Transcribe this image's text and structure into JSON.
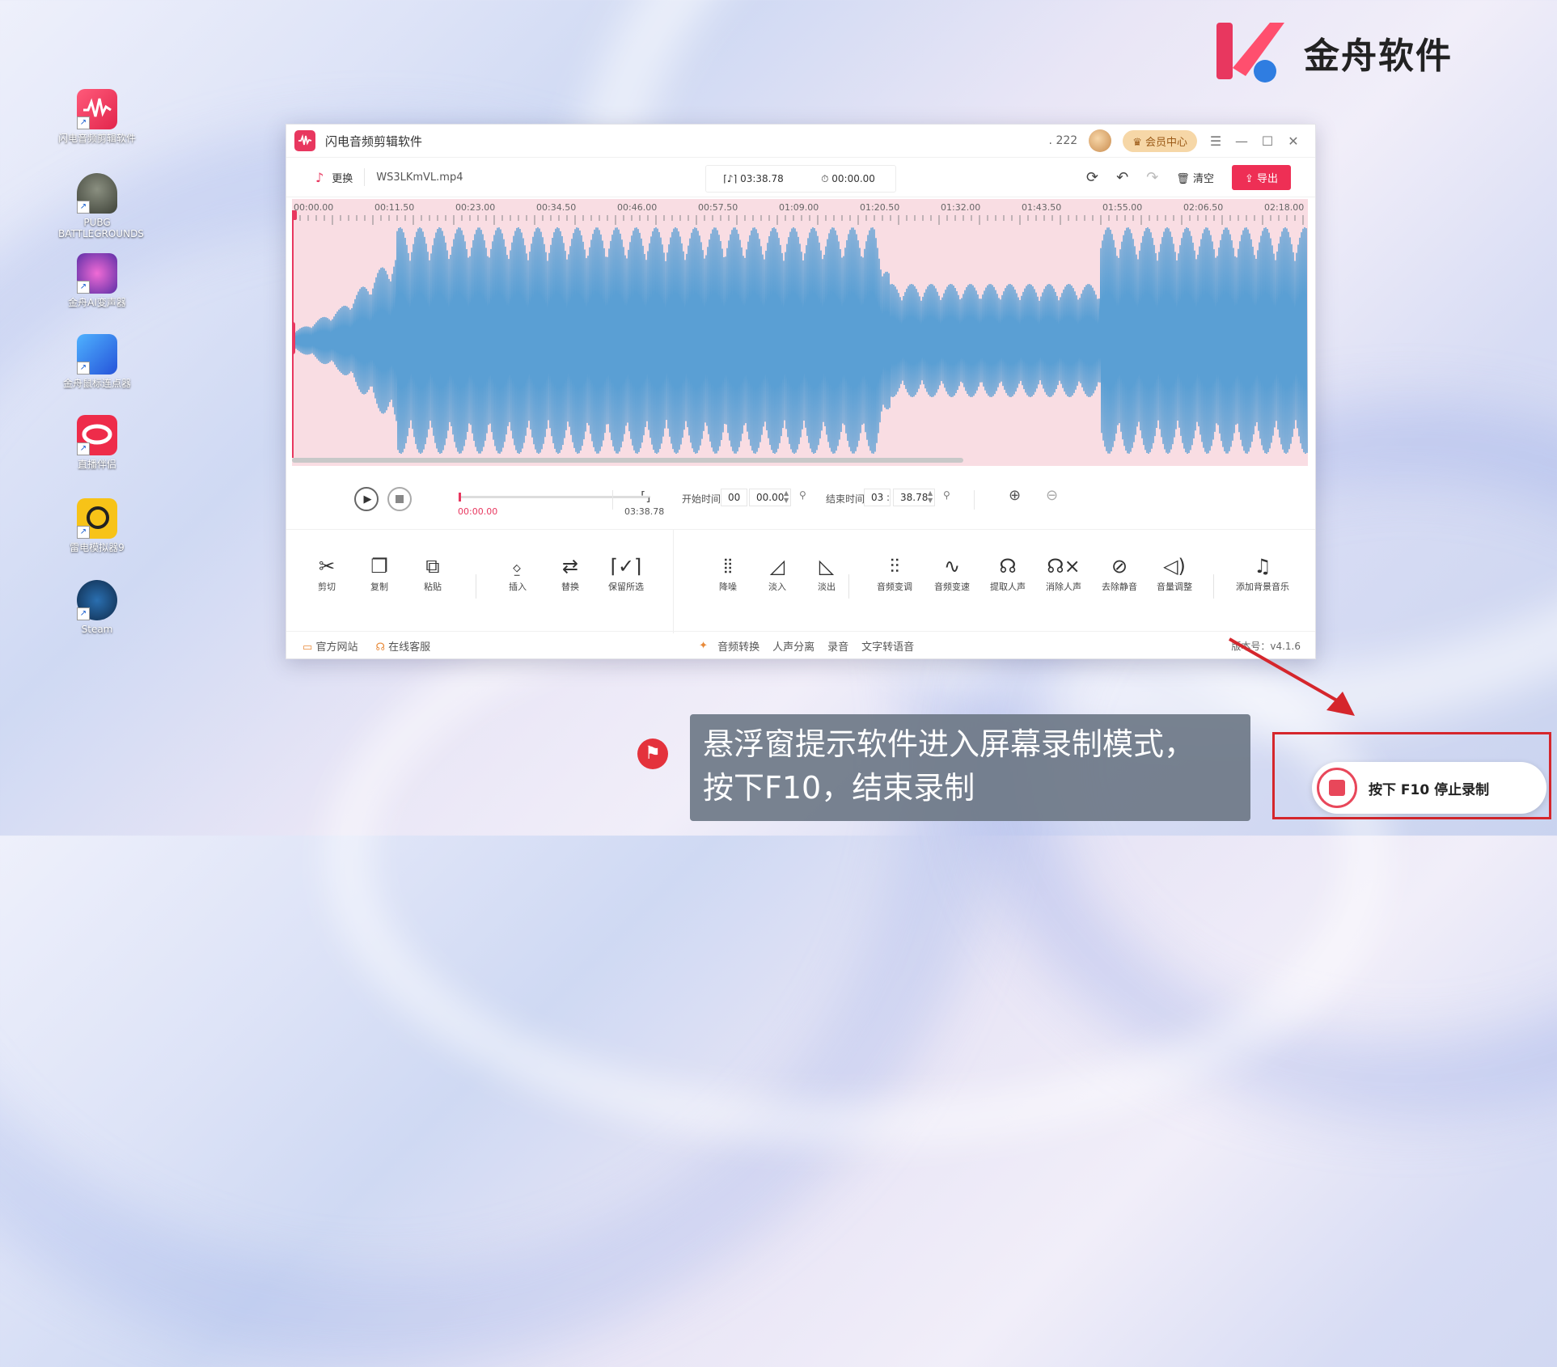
{
  "desktop": {
    "icons": [
      {
        "label": "闪电音频剪辑软件",
        "icon": "lightning-audio-icon"
      },
      {
        "label": "PUBG BATTLEGROUNDS",
        "icon": "pubg-helmet-icon"
      },
      {
        "label": "金舟AI变声器",
        "icon": "voice-changer-icon"
      },
      {
        "label": "金舟鼠标连点器",
        "icon": "mouse-clicker-icon"
      },
      {
        "label": "直播伴侣",
        "icon": "live-assistant-icon"
      },
      {
        "label": "雷电模拟器9",
        "icon": "ldplayer-icon"
      },
      {
        "label": "Steam",
        "icon": "steam-icon"
      }
    ]
  },
  "brand": {
    "name": "金舟软件",
    "accent": "#e8375f"
  },
  "app": {
    "title": "闪电音频剪辑软件",
    "user_count": "222",
    "vip_label": "会员中心",
    "toolbar": {
      "replace_label": "更换",
      "file_name": "WS3LKmVL.mp4",
      "duration": "03:38.78",
      "selection": "00:00.00",
      "clear_label": "清空",
      "export_label": "导出"
    },
    "ruler_ticks": [
      "00:00.00",
      "00:11.50",
      "00:23.00",
      "00:34.50",
      "00:46.00",
      "00:57.50",
      "01:09.00",
      "01:20.50",
      "01:32.00",
      "01:43.50",
      "01:55.00",
      "02:06.50",
      "02:18.00"
    ],
    "transport": {
      "current_time": "00:00.00",
      "total_time": "03:38.78",
      "start_label": "开始时间",
      "start_min": "00",
      "start_sec": "00.00",
      "end_label": "结束时间",
      "end_min": "03",
      "end_sec": "38.78"
    },
    "tools": [
      {
        "label": "剪切",
        "icon": "scissors-icon"
      },
      {
        "label": "复制",
        "icon": "copy-icon"
      },
      {
        "label": "粘贴",
        "icon": "paste-icon"
      },
      {
        "label": "插入",
        "icon": "insert-icon"
      },
      {
        "label": "替换",
        "icon": "replace-icon"
      },
      {
        "label": "保留所选",
        "icon": "keep-selection-icon"
      },
      {
        "label": "降噪",
        "icon": "denoise-icon"
      },
      {
        "label": "淡入",
        "icon": "fade-in-icon"
      },
      {
        "label": "淡出",
        "icon": "fade-out-icon"
      },
      {
        "label": "音频变调",
        "icon": "pitch-icon"
      },
      {
        "label": "音频变速",
        "icon": "speed-icon"
      },
      {
        "label": "提取人声",
        "icon": "extract-voice-icon"
      },
      {
        "label": "消除人声",
        "icon": "remove-voice-icon"
      },
      {
        "label": "去除静音",
        "icon": "remove-silence-icon"
      },
      {
        "label": "音量调整",
        "icon": "volume-icon"
      },
      {
        "label": "添加背景音乐",
        "icon": "music-note-icon"
      }
    ],
    "footer": {
      "website": "官方网站",
      "support": "在线客服",
      "links": [
        "音频转换",
        "人声分离",
        "录音",
        "文字转语音"
      ],
      "version": "版本号：v4.1.6"
    }
  },
  "annotation": {
    "line1": "悬浮窗提示软件进入屏幕录制模式，",
    "line2": "按下F10，结束录制"
  },
  "recorder": {
    "stop_label": "按下 F10 停止录制",
    "color": "#e8475a"
  }
}
